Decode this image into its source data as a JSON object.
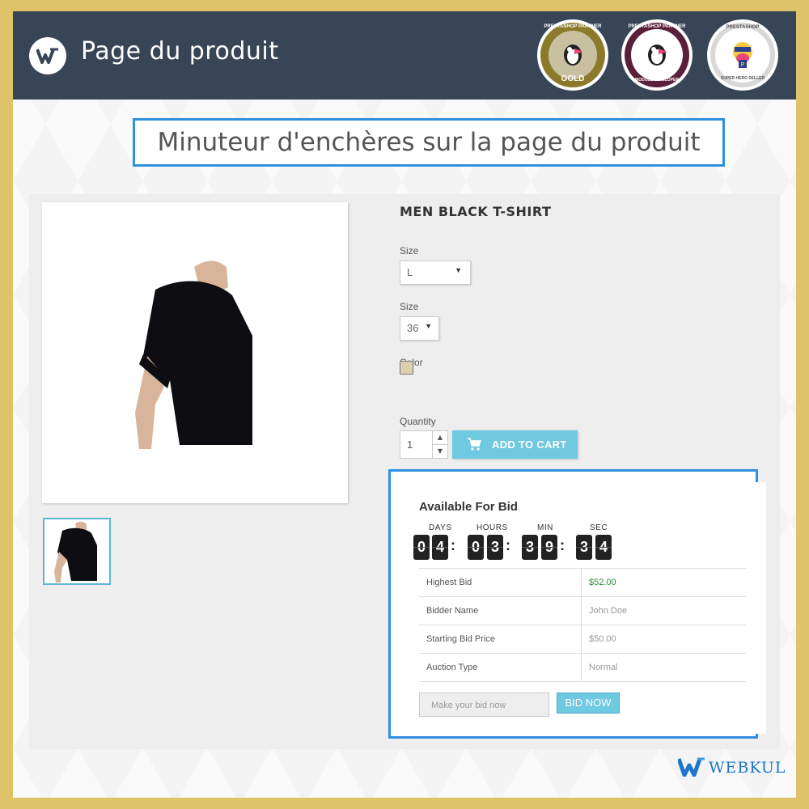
{
  "header": {
    "title": "Page du produit",
    "badges": [
      {
        "name": "prestashop-partner-gold",
        "line1": "PRESTASHOP PARTNER",
        "line2": "GOLD",
        "color": "#8a7a2a"
      },
      {
        "name": "prestashop-partner-module-developer",
        "line1": "PRESTASHOP PARTNER",
        "line2": "MODULE DEVELOPER",
        "color": "#5a1f3a"
      },
      {
        "name": "prestashop-super-hero-seller",
        "line1": "PRESTASHOP",
        "line2": "SUPER HERO SELLER",
        "color": "#3a3a3a"
      }
    ]
  },
  "subtitle": "Minuteur d'enchères sur la page du produit",
  "product": {
    "title": "MEN BLACK T-SHIRT",
    "size_label_1": "Size",
    "size_value_1": "L",
    "size_label_2": "Size",
    "size_value_2": "36",
    "color_label": "Color",
    "color_swatch": "#ddd0b0",
    "quantity_label": "Quantity",
    "quantity_value": "1",
    "add_to_cart": "ADD TO CART"
  },
  "auction": {
    "title": "Available For Bid",
    "timer_labels": {
      "days": "DAYS",
      "hours": "HOURS",
      "min": "MIN",
      "sec": "SEC"
    },
    "digits": {
      "d1": "0",
      "d2": "4",
      "h1": "0",
      "h2": "3",
      "m1": "3",
      "m2": "9",
      "s1": "3",
      "s2": "4"
    },
    "rows": [
      {
        "key": "Highest Bid",
        "value": "$52.00",
        "color": "#2e8b2e"
      },
      {
        "key": "Bidder Name",
        "value": "John Doe",
        "color": "#999999"
      },
      {
        "key": "Starting Bid Price",
        "value": "$50.00",
        "color": "#999999"
      },
      {
        "key": "Auction Type",
        "value": "Normal",
        "color": "#999999"
      }
    ],
    "bid_placeholder": "Make your bid now",
    "bid_button": "BID NOW"
  },
  "footer": {
    "brand": "WEBKUL"
  },
  "colors": {
    "accent": "#2f8fe0",
    "button": "#6fc9e0",
    "header": "#374556",
    "frame": "#dfc36a"
  }
}
